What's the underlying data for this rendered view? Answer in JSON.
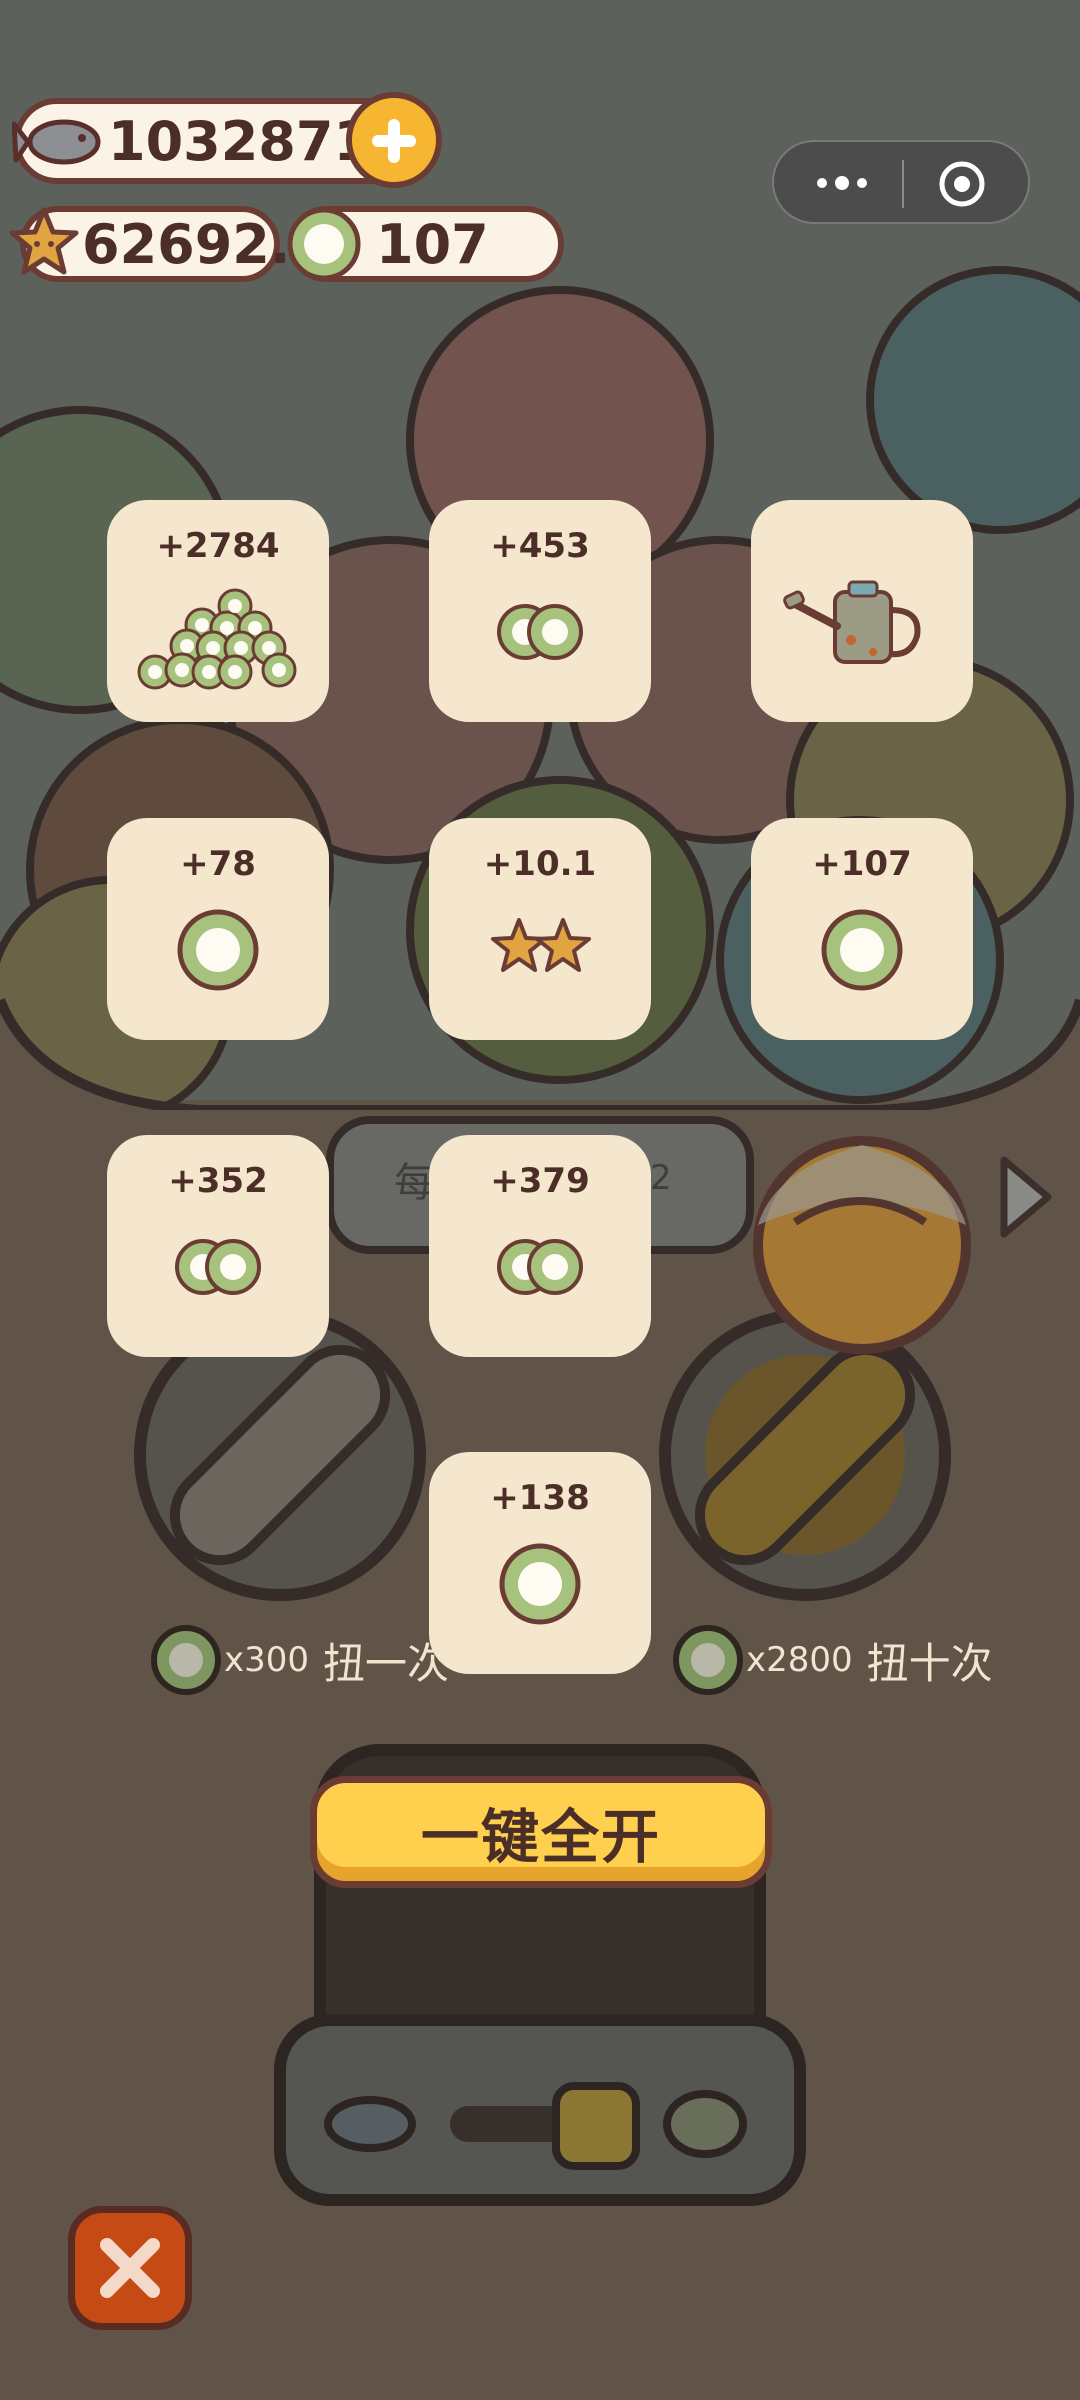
{
  "currency": {
    "fish": "10328711",
    "stars": "62692.2",
    "coins": "107"
  },
  "rewards": [
    {
      "amount": "+2784",
      "icon": "coin-pile-icon"
    },
    {
      "amount": "+453",
      "icon": "double-coin-icon"
    },
    {
      "amount": "",
      "icon": "watering-can-icon"
    },
    {
      "amount": "+78",
      "icon": "coin-icon"
    },
    {
      "amount": "+10.1",
      "icon": "double-star-icon"
    },
    {
      "amount": "+107",
      "icon": "coin-icon"
    },
    {
      "amount": "+352",
      "icon": "double-coin-icon"
    },
    {
      "amount": "+379",
      "icon": "double-coin-icon"
    },
    {
      "amount": "+138",
      "icon": "coin-icon"
    }
  ],
  "gacha": {
    "single_cost": "x300",
    "single_label": "扭一次",
    "ten_cost": "x2800",
    "ten_label": "扭十次",
    "partial_left": "每",
    "partial_right": "2"
  },
  "open_all_label": "一键全开",
  "colors": {
    "accent": "#ffd04d",
    "card": "#f5e7cd",
    "outline": "#6b3c33"
  }
}
